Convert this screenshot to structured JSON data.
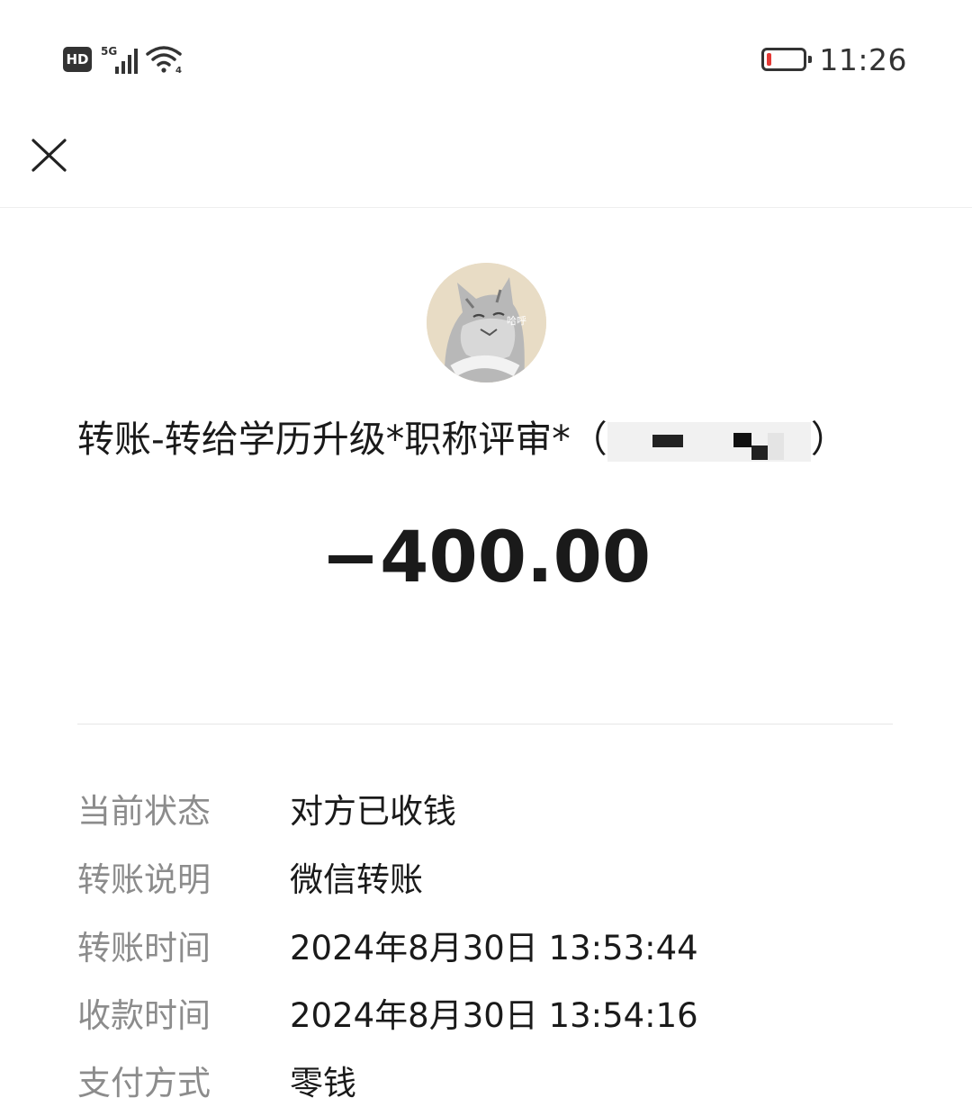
{
  "status_bar": {
    "hd_label": "HD",
    "network_label": "5G",
    "wifi_label": "4",
    "time": "11:26",
    "battery_color": "#e53935",
    "battery_level": 0.12
  },
  "nav": {
    "close_icon": "close-icon"
  },
  "avatar": {
    "caption": "哈呼"
  },
  "transfer": {
    "title_prefix": "转账-转给学历升级*职称评审*（",
    "title_suffix": "）",
    "amount": "−400.00"
  },
  "details": [
    {
      "label": "当前状态",
      "value": "对方已收钱"
    },
    {
      "label": "转账说明",
      "value": "微信转账"
    },
    {
      "label": "转账时间",
      "value": "2024年8月30日 13:53:44"
    },
    {
      "label": "收款时间",
      "value": "2024年8月30日 13:54:16"
    },
    {
      "label": "支付方式",
      "value": "零钱"
    }
  ]
}
